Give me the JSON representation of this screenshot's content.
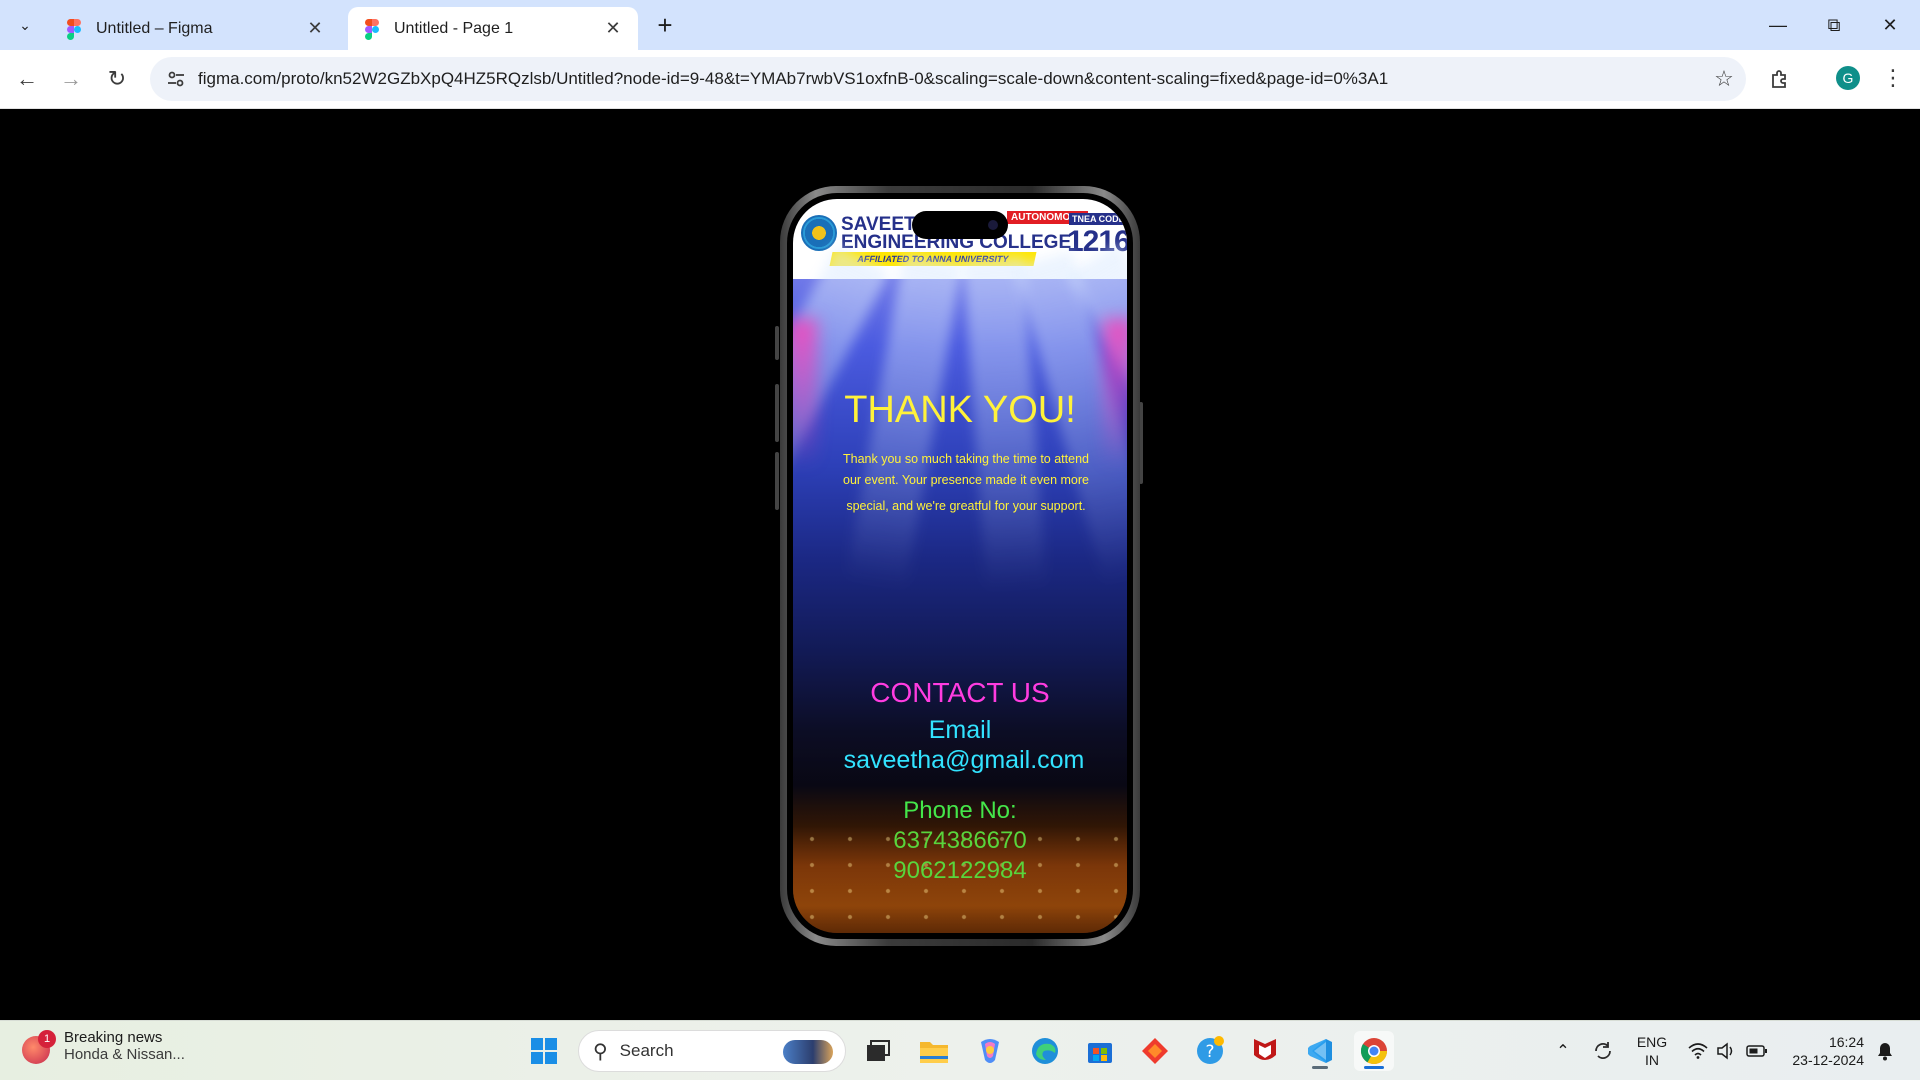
{
  "browser": {
    "tabs": [
      {
        "title": "Untitled – Figma",
        "active": false
      },
      {
        "title": "Untitled - Page 1",
        "active": true
      }
    ],
    "url": "figma.com/proto/kn52W2GZbXpQ4HZ5RQzlsb/Untitled?node-id=9-48&t=YMAb7rwbVS1oxfnB-0&scaling=scale-down&content-scaling=fixed&page-id=0%3A1",
    "profile_initial": "G",
    "accent": "#d3e3fd"
  },
  "prototype": {
    "header": {
      "college_line1": "SAVEETHA",
      "college_line2": "ENGINEERING COLLEGE",
      "autonomous_badge": "AUTONOMOUS",
      "affiliated": "AFFILIATED TO ANNA UNIVERSITY",
      "tnea_label": "TNEA CODE",
      "tnea_code": "1216"
    },
    "thank_you": {
      "title": "THANK YOU!",
      "line1": "Thank you so much taking the time to attend",
      "line2": "our event.  Your presence made it even more",
      "line3": "special, and we're greatful for your support."
    },
    "contact": {
      "title": "CONTACT US",
      "email_label": "Email",
      "email": "saveetha@gmail.com",
      "phone_label": "Phone No:",
      "phones": [
        "6374386670",
        "9062122984"
      ]
    },
    "colors": {
      "thank_you": "#fff23a",
      "contact_title": "#ff3ce0",
      "email": "#32e3ff",
      "phone": "#44e64a"
    }
  },
  "taskbar": {
    "news_title": "Breaking news",
    "news_subtitle": "Honda & Nissan...",
    "news_badge": "1",
    "search_placeholder": "Search",
    "pinned_icons": [
      "task-view-icon",
      "file-explorer-icon",
      "copilot-icon",
      "edge-icon",
      "store-icon",
      "figma-like-app-icon",
      "help-icon",
      "mcafee-icon",
      "vscode-icon",
      "chrome-icon"
    ],
    "lang_line1": "ENG",
    "lang_line2": "IN",
    "time": "16:24",
    "date": "23-12-2024"
  }
}
